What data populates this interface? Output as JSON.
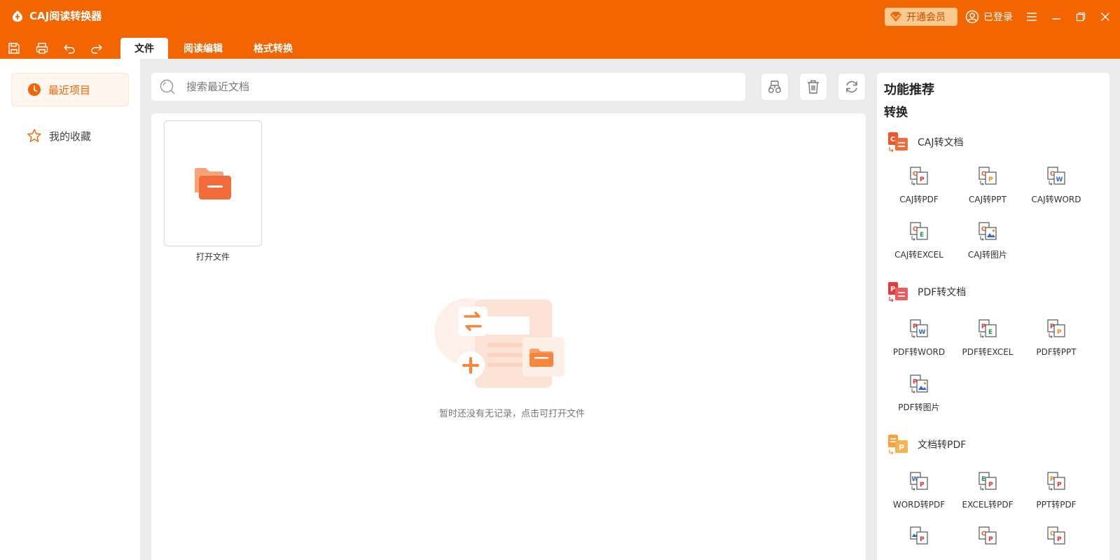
{
  "app": {
    "title": "CAJ阅读转换器",
    "accent": "#f26500",
    "vip_label": "开通会员",
    "user_label": "已登录"
  },
  "toolbar": {
    "tabs": [
      {
        "label": "文件",
        "active": true
      },
      {
        "label": "阅读编辑",
        "active": false
      },
      {
        "label": "格式转换",
        "active": false
      }
    ]
  },
  "sidebar": {
    "items": [
      {
        "label": "最近项目",
        "icon": "clock-icon",
        "active": true
      },
      {
        "label": "我的收藏",
        "icon": "star-icon",
        "active": false
      }
    ]
  },
  "search": {
    "placeholder": "搜索最近文档",
    "value": ""
  },
  "main": {
    "open_file_label": "打开文件",
    "empty_text": "暂时还没有无记录，点击可打开文件"
  },
  "right_panel": {
    "title": "功能推荐",
    "subtitle": "转换",
    "groups": [
      {
        "label": "CAJ转文档",
        "items": [
          {
            "label": "CAJ转PDF"
          },
          {
            "label": "CAJ转PPT"
          },
          {
            "label": "CAJ转WORD"
          },
          {
            "label": "CAJ转EXCEL"
          },
          {
            "label": "CAJ转图片"
          }
        ]
      },
      {
        "label": "PDF转文档",
        "items": [
          {
            "label": "PDF转WORD"
          },
          {
            "label": "PDF转EXCEL"
          },
          {
            "label": "PDF转PPT"
          },
          {
            "label": "PDF转图片"
          }
        ]
      },
      {
        "label": "文档转PDF",
        "items": [
          {
            "label": "WORD转PDF"
          },
          {
            "label": "EXCEL转PDF"
          },
          {
            "label": "PPT转PDF"
          }
        ]
      }
    ]
  }
}
